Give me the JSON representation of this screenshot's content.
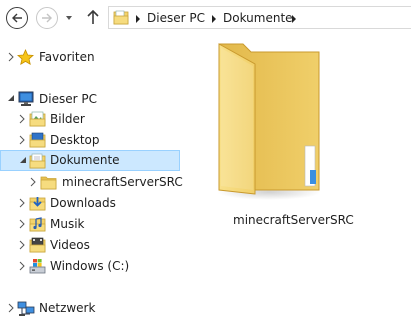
{
  "nav": {
    "back_icon": "arrow-left-icon",
    "forward_icon": "arrow-right-icon",
    "recent_icon": "chevron-down-icon",
    "up_icon": "arrow-up-icon"
  },
  "breadcrumb": {
    "items": [
      {
        "label": "Dieser PC"
      },
      {
        "label": "Dokumente"
      }
    ]
  },
  "tree": {
    "favorites": {
      "label": "Favoriten",
      "icon": "star-icon",
      "color": "#f2b600"
    },
    "this_pc": {
      "label": "Dieser PC",
      "icon": "computer-icon"
    },
    "items": [
      {
        "label": "Bilder",
        "icon": "pictures-folder-icon"
      },
      {
        "label": "Desktop",
        "icon": "desktop-folder-icon"
      },
      {
        "label": "Dokumente",
        "icon": "documents-folder-icon",
        "selected": true
      },
      {
        "label": "minecraftServerSRC",
        "icon": "folder-icon"
      },
      {
        "label": "Downloads",
        "icon": "downloads-folder-icon"
      },
      {
        "label": "Musik",
        "icon": "music-folder-icon"
      },
      {
        "label": "Videos",
        "icon": "videos-folder-icon"
      },
      {
        "label": "Windows (C:)",
        "icon": "drive-icon"
      }
    ],
    "network": {
      "label": "Netzwerk",
      "icon": "network-icon"
    }
  },
  "content": {
    "items": [
      {
        "label": "minecraftServerSRC",
        "icon": "folder-icon"
      }
    ]
  },
  "colors": {
    "selection_bg": "#cce8ff",
    "selection_border": "#99d1ff",
    "folder": "#f3d36b"
  }
}
